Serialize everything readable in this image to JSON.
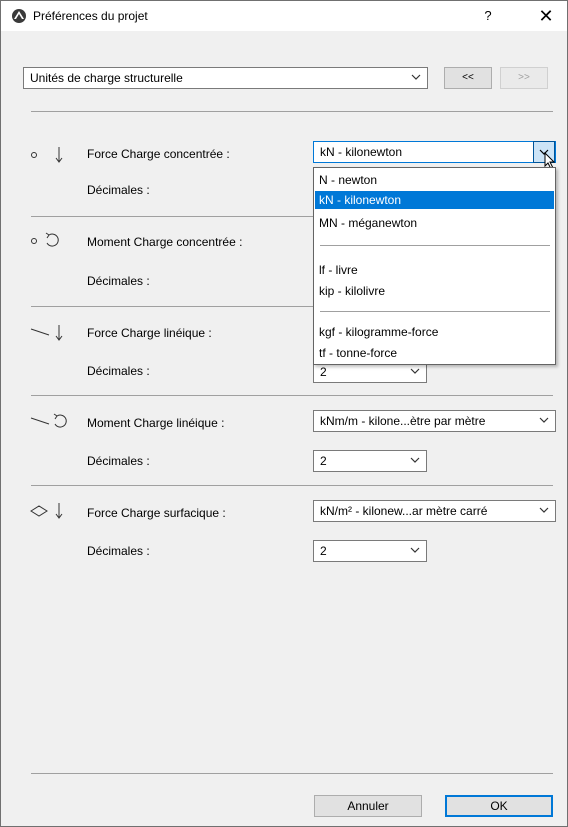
{
  "window": {
    "title": "Préférences du projet",
    "help": "?",
    "close": "✕"
  },
  "top": {
    "category": "Unités de charge structurelle",
    "prev": "<<",
    "next": ">>"
  },
  "rows": [
    {
      "label": "Force Charge concentrée :",
      "icon": "point-force-icon",
      "value": "kN - kilonewton",
      "decimals_label": "Décimales :",
      "decimals": ""
    },
    {
      "label": "Moment Charge concentrée :",
      "icon": "point-moment-icon",
      "value": "",
      "decimals_label": "Décimales :",
      "decimals": ""
    },
    {
      "label": "Force Charge linéique :",
      "icon": "line-force-icon",
      "value": "",
      "decimals_label": "Décimales :",
      "decimals": "2"
    },
    {
      "label": "Moment Charge linéique :",
      "icon": "line-moment-icon",
      "value": "kNm/m - kilone...ètre par mètre",
      "decimals_label": "Décimales :",
      "decimals": "2"
    },
    {
      "label": "Force Charge surfacique :",
      "icon": "area-force-icon",
      "value": "kN/m² - kilonew...ar mètre carré",
      "decimals_label": "Décimales :",
      "decimals": "2"
    }
  ],
  "dropdown": {
    "options": [
      {
        "label": "N - newton",
        "selected": false
      },
      {
        "label": "kN - kilonewton",
        "selected": true
      },
      {
        "label": "MN - méganewton",
        "selected": false
      },
      {
        "label": "lf - livre",
        "selected": false
      },
      {
        "label": "kip - kilolivre",
        "selected": false
      },
      {
        "label": "kgf - kilogramme-force",
        "selected": false
      },
      {
        "label": "tf - tonne-force",
        "selected": false
      }
    ]
  },
  "buttons": {
    "cancel": "Annuler",
    "ok": "OK"
  },
  "colors": {
    "selection": "#0078d7",
    "window_bg": "#f0f0f0"
  }
}
